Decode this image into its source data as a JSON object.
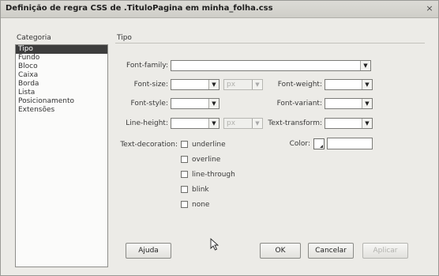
{
  "dialog": {
    "title": "Definição de regra CSS de .TituloPagina em minha_folha.css",
    "close_glyph": "×"
  },
  "category": {
    "label": "Categoria",
    "items": [
      "Tipo",
      "Fundo",
      "Bloco",
      "Caixa",
      "Borda",
      "Lista",
      "Posicionamento",
      "Extensões"
    ],
    "selected": "Tipo"
  },
  "section": {
    "label": "Tipo"
  },
  "fields": {
    "font_family_label": "Font-family:",
    "font_size_label": "Font-size:",
    "font_size_unit": "px",
    "font_weight_label": "Font-weight:",
    "font_style_label": "Font-style:",
    "font_variant_label": "Font-variant:",
    "line_height_label": "Line-height:",
    "line_height_unit": "px",
    "text_transform_label": "Text-transform:",
    "text_decoration_label": "Text-decoration:",
    "color_label": "Color:",
    "decoration_options": [
      "underline",
      "overline",
      "line-through",
      "blink",
      "none"
    ]
  },
  "buttons": {
    "help": "Ajuda",
    "ok": "OK",
    "cancel": "Cancelar",
    "apply": "Aplicar"
  },
  "icons": {
    "dropdown": "chevron-down-icon",
    "cursor": "mouse-pointer-icon",
    "close": "close-icon"
  }
}
